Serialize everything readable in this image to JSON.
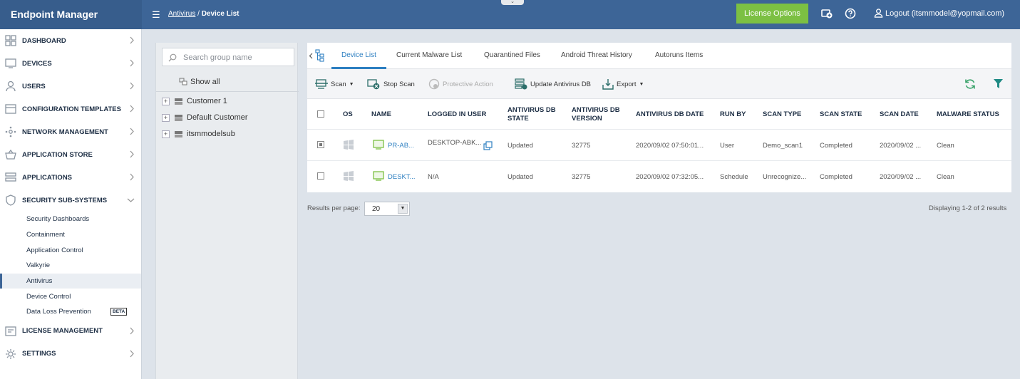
{
  "app": {
    "title": "Endpoint Manager",
    "breadcrumb_link": "Antivirus",
    "breadcrumb_sep": "/",
    "breadcrumb_current": "Device List",
    "license_button": "License Options",
    "logout": "Logout (itsmmodel@yopmail.com)"
  },
  "sidebar": {
    "items": [
      {
        "label": "DASHBOARD",
        "icon": "dashboard-icon"
      },
      {
        "label": "DEVICES",
        "icon": "devices-icon"
      },
      {
        "label": "USERS",
        "icon": "users-icon"
      },
      {
        "label": "CONFIGURATION TEMPLATES",
        "icon": "templates-icon"
      },
      {
        "label": "NETWORK MANAGEMENT",
        "icon": "network-icon"
      },
      {
        "label": "APPLICATION STORE",
        "icon": "store-icon"
      },
      {
        "label": "APPLICATIONS",
        "icon": "applications-icon"
      },
      {
        "label": "SECURITY SUB-SYSTEMS",
        "icon": "shield-icon"
      }
    ],
    "sub_items": [
      "Security Dashboards",
      "Containment",
      "Application Control",
      "Valkyrie",
      "Antivirus",
      "Device Control",
      "Data Loss Prevention"
    ],
    "beta": "BETA",
    "bottom_items": [
      {
        "label": "LICENSE MANAGEMENT",
        "icon": "license-icon"
      },
      {
        "label": "SETTINGS",
        "icon": "gear-icon"
      }
    ]
  },
  "tree": {
    "search_placeholder": "Search group name",
    "show_all": "Show all",
    "groups": [
      "Customer 1",
      "Default Customer",
      "itsmmodelsub"
    ]
  },
  "tabs": [
    "Device List",
    "Current Malware List",
    "Quarantined Files",
    "Android Threat History",
    "Autoruns Items"
  ],
  "toolbar": {
    "scan": "Scan",
    "stop_scan": "Stop Scan",
    "protective_action": "Protective Action",
    "update_db": "Update Antivirus DB",
    "export": "Export"
  },
  "table": {
    "headers": [
      "OS",
      "NAME",
      "LOGGED IN USER",
      "ANTIVIRUS DB STATE",
      "ANTIVIRUS DB VERSION",
      "ANTIVIRUS DB DATE",
      "RUN BY",
      "SCAN TYPE",
      "SCAN STATE",
      "SCAN DATE",
      "MALWARE STATUS"
    ],
    "rows": [
      {
        "name": "PR-AB...",
        "user": "DESKTOP-ABK...",
        "db_state": "Updated",
        "db_version": "32775",
        "db_date": "2020/09/02 07:50:01...",
        "run_by": "User",
        "scan_type": "Demo_scan1",
        "scan_state": "Completed",
        "scan_date": "2020/09/02 ...",
        "malware": "Clean"
      },
      {
        "name": "DESKT...",
        "user": "N/A",
        "db_state": "Updated",
        "db_version": "32775",
        "db_date": "2020/09/02 07:32:05...",
        "run_by": "Schedule",
        "scan_type": "Unrecognize...",
        "scan_state": "Completed",
        "scan_date": "2020/09/02 ...",
        "malware": "Clean"
      }
    ]
  },
  "footer": {
    "results_label": "Results per page:",
    "results_value": "20",
    "displaying": "Displaying 1-2 of 2 results"
  }
}
